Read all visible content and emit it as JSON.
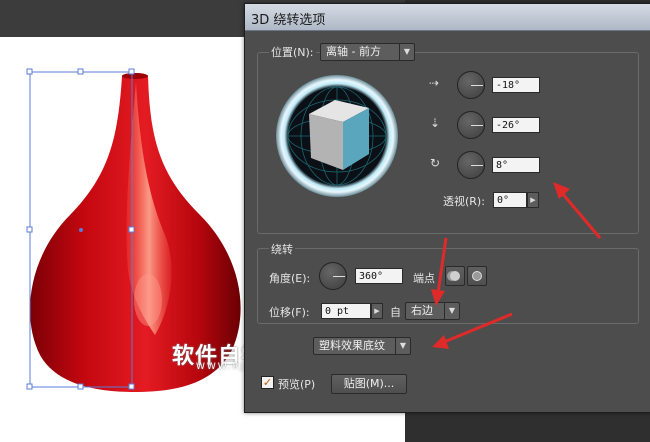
{
  "dialog": {
    "title": "3D 绕转选项",
    "position": {
      "label": "位置(N):",
      "value": "离轴 - 前方",
      "x_angle": "-18°",
      "y_angle": "-26°",
      "z_angle": "8°",
      "perspective_label": "透视(R):",
      "perspective_value": "0°"
    },
    "revolve": {
      "section_label": "绕转",
      "angle_label": "角度(E):",
      "angle_value": "360°",
      "cap_label": "端点",
      "offset_label": "位移(F):",
      "offset_value": "0 pt",
      "from_label": "自",
      "from_value": "右边"
    },
    "surface": {
      "value": "塑料效果底纹"
    },
    "preview_label": "预览(P)",
    "preview_checked": true,
    "map_button": "贴图(M)..."
  },
  "watermark": {
    "text": "软件自学网",
    "url": "WWW.RJZXW.COM"
  },
  "colors": {
    "annotation_arrow": "#e02a2a",
    "shape_red": "#d10a12",
    "selection": "#5b7bd8"
  }
}
